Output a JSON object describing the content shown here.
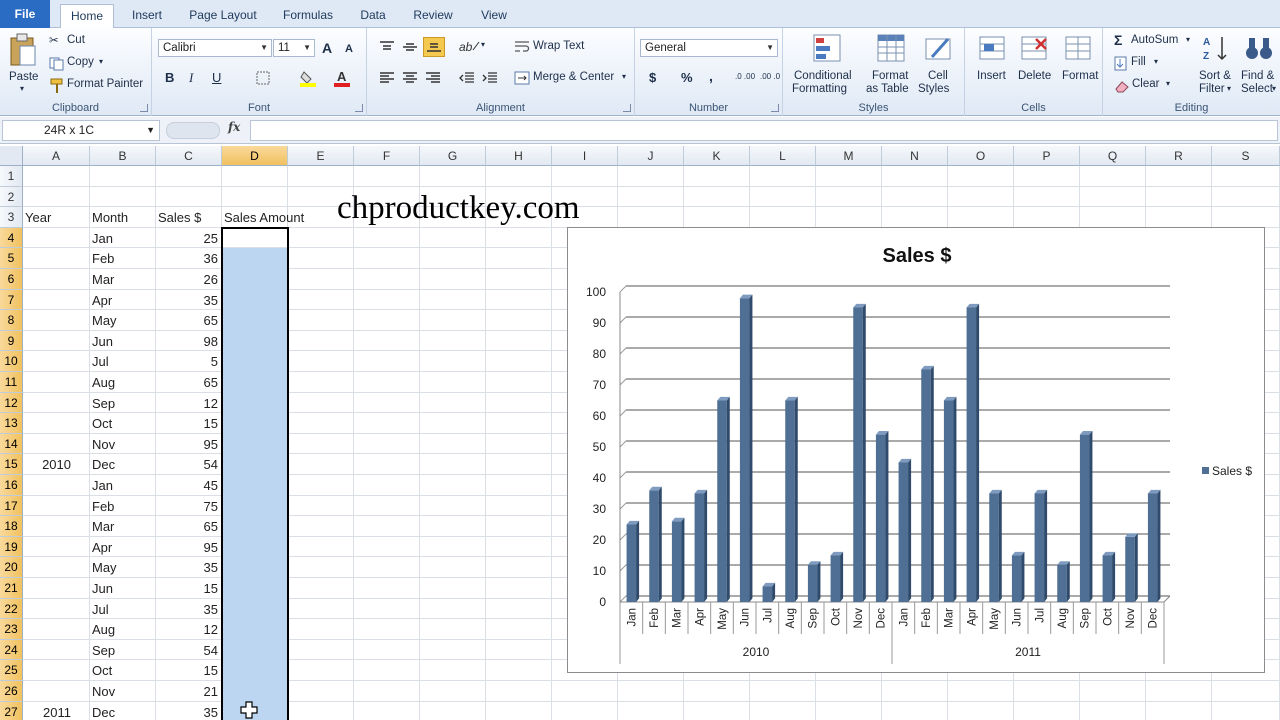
{
  "tabs": [
    "File",
    "Home",
    "Insert",
    "Page Layout",
    "Formulas",
    "Data",
    "Review",
    "View"
  ],
  "ribbon": {
    "clipboard": {
      "paste": "Paste",
      "cut": "Cut",
      "copy": "Copy",
      "format_painter": "Format Painter",
      "label": "Clipboard"
    },
    "font": {
      "name": "Calibri",
      "size": "11",
      "bold": "B",
      "italic": "I",
      "underline": "U",
      "grow": "A",
      "shrink": "A",
      "label": "Font"
    },
    "alignment": {
      "wrap": "Wrap Text",
      "merge": "Merge & Center",
      "label": "Alignment"
    },
    "number": {
      "format": "General",
      "currency": "$",
      "percent": "%",
      "comma": ",",
      "inc": ".0 .00",
      "dec": ".00 .0",
      "label": "Number"
    },
    "styles": {
      "conditional": "Conditional",
      "conditional2": "Formatting",
      "table": "Format",
      "table2": "as Table",
      "cell": "Cell",
      "cell2": "Styles",
      "label": "Styles"
    },
    "cells": {
      "insert": "Insert",
      "delete": "Delete",
      "format": "Format",
      "label": "Cells"
    },
    "editing": {
      "autosum": "AutoSum",
      "fill": "Fill",
      "clear": "Clear",
      "sort": "Sort &",
      "sort2": "Filter",
      "find": "Find &",
      "find2": "Select",
      "label": "Editing"
    }
  },
  "formula_bar": {
    "name_box": "24R x 1C",
    "fx": "fx",
    "value": ""
  },
  "columns": [
    "A",
    "B",
    "C",
    "D",
    "E",
    "F",
    "G",
    "H",
    "I",
    "J",
    "K",
    "L",
    "M",
    "N",
    "O",
    "P",
    "Q",
    "R",
    "S"
  ],
  "rows": [
    "1",
    "2",
    "3",
    "4",
    "5",
    "6",
    "7",
    "8",
    "9",
    "10",
    "11",
    "12",
    "13",
    "14",
    "15",
    "16",
    "17",
    "18",
    "19",
    "20",
    "21",
    "22",
    "23",
    "24",
    "25",
    "26",
    "27"
  ],
  "headers": {
    "year": "Year",
    "month": "Month",
    "sales": "Sales $",
    "amount": "Sales Amount"
  },
  "year_labels": [
    {
      "row": 15,
      "text": "2010"
    },
    {
      "row": 27,
      "text": "2011"
    }
  ],
  "table": [
    [
      "Jan",
      "25"
    ],
    [
      "Feb",
      "36"
    ],
    [
      "Mar",
      "26"
    ],
    [
      "Apr",
      "35"
    ],
    [
      "May",
      "65"
    ],
    [
      "Jun",
      "98"
    ],
    [
      "Jul",
      "5"
    ],
    [
      "Aug",
      "65"
    ],
    [
      "Sep",
      "12"
    ],
    [
      "Oct",
      "15"
    ],
    [
      "Nov",
      "95"
    ],
    [
      "Dec",
      "54"
    ],
    [
      "Jan",
      "45"
    ],
    [
      "Feb",
      "75"
    ],
    [
      "Mar",
      "65"
    ],
    [
      "Apr",
      "95"
    ],
    [
      "May",
      "35"
    ],
    [
      "Jun",
      "15"
    ],
    [
      "Jul",
      "35"
    ],
    [
      "Aug",
      "12"
    ],
    [
      "Sep",
      "54"
    ],
    [
      "Oct",
      "15"
    ],
    [
      "Nov",
      "21"
    ],
    [
      "Dec",
      "35"
    ]
  ],
  "watermark": "chproductkey.com",
  "chart_data": {
    "type": "bar",
    "title": "Sales $",
    "categories": [
      "Jan",
      "Feb",
      "Mar",
      "Apr",
      "May",
      "Jun",
      "Jul",
      "Aug",
      "Sep",
      "Oct",
      "Nov",
      "Dec",
      "Jan",
      "Feb",
      "Mar",
      "Apr",
      "May",
      "Jun",
      "Jul",
      "Aug",
      "Sep",
      "Oct",
      "Nov",
      "Dec"
    ],
    "groups": [
      "2010",
      "2011"
    ],
    "series": [
      {
        "name": "Sales $",
        "values": [
          25,
          36,
          26,
          35,
          65,
          98,
          5,
          65,
          12,
          15,
          95,
          54,
          45,
          75,
          65,
          95,
          35,
          15,
          35,
          12,
          54,
          15,
          21,
          35
        ]
      }
    ],
    "yticks": [
      "0",
      "10",
      "20",
      "30",
      "40",
      "50",
      "60",
      "70",
      "80",
      "90",
      "100"
    ],
    "ylim": [
      0,
      100
    ],
    "grid": true,
    "legend": "right",
    "bar_color": "#4f6f94"
  }
}
